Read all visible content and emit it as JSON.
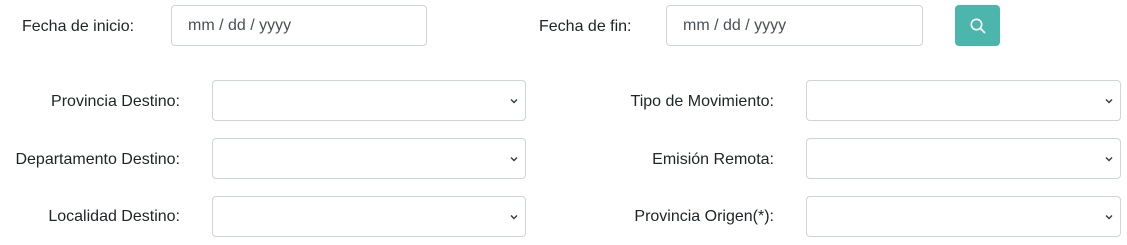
{
  "dates": {
    "start_label": "Fecha de inicio:",
    "start_placeholder": "mm / dd / yyyy",
    "end_label": "Fecha de fin:",
    "end_placeholder": "mm / dd / yyyy"
  },
  "search_button": {
    "icon": "search-icon",
    "color": "#4db6ac"
  },
  "filters_left": {
    "provincia_destino_label": "Provincia Destino:",
    "departamento_destino_label": "Departamento Destino:",
    "localidad_destino_label": "Localidad Destino:"
  },
  "filters_right": {
    "tipo_movimiento_label": "Tipo de Movimiento:",
    "emision_remota_label": "Emisión Remota:",
    "provincia_origen_label": "Provincia Origen(*):"
  },
  "selects": {
    "provincia_destino_value": "",
    "departamento_destino_value": "",
    "localidad_destino_value": "",
    "tipo_movimiento_value": "",
    "emision_remota_value": "",
    "provincia_origen_value": ""
  }
}
